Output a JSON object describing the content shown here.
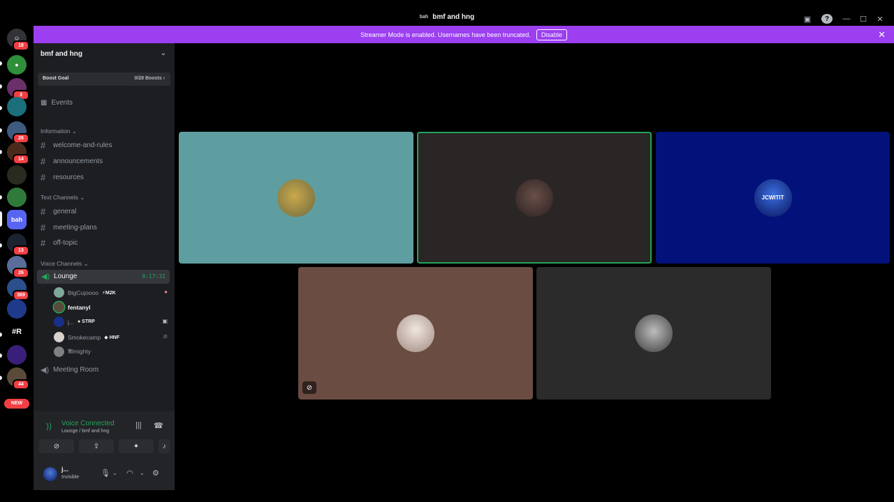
{
  "window": {
    "title": "bmf and hng",
    "title_badge": "bah"
  },
  "banner": {
    "text": "Streamer Mode is enabled. Usernames have been truncated.",
    "button": "Disable"
  },
  "rail": {
    "badges": [
      "18",
      "3",
      "26",
      "14",
      "13",
      "26",
      "369",
      "44"
    ],
    "selected_label": "bah",
    "text_server": "#R",
    "new_label": "NEW"
  },
  "sidebar": {
    "guild_name": "bmf and hng",
    "boost": {
      "label": "Boost Goal",
      "progress": "0/28 Boosts"
    },
    "events": "Events",
    "categories": {
      "information": "Information",
      "text": "Text Channels",
      "voice": "Voice Channels"
    },
    "info_channels": [
      "welcome-and-rules",
      "announcements",
      "resources"
    ],
    "text_channels": [
      "general",
      "meeting-plans",
      "off-topic"
    ],
    "voice_channels": {
      "lounge": {
        "name": "Lounge",
        "timer": "9:17:31"
      },
      "meeting": "Meeting Room"
    },
    "members": [
      {
        "name": "BigCujoooo",
        "tag": "M2K"
      },
      {
        "name": "fentanyl",
        "tag": ""
      },
      {
        "name": "j...",
        "tag": "STRP"
      },
      {
        "name": "Smokecamp",
        "tag": "HNF"
      },
      {
        "name": "𝕬lmighty",
        "tag": ""
      }
    ]
  },
  "voice_panel": {
    "status": "Voice Connected",
    "location": "Lounge / bmf and hng",
    "user_name": "j...",
    "user_status": "Invisible"
  },
  "tiles": [
    {
      "bg": "#5f9ea0",
      "avatar_text": ""
    },
    {
      "bg": "#2a2625",
      "avatar_text": ""
    },
    {
      "bg": "#03127a",
      "avatar_text": "JCWITIT"
    },
    {
      "bg": "#6a4c43",
      "avatar_text": ""
    },
    {
      "bg": "#2b2b2b",
      "avatar_text": ""
    }
  ],
  "colors": {
    "banner": "#9b3ff0",
    "voice_green": "#23a55a",
    "badge_red": "#f23f43",
    "sidebar_bg": "#1d1e22"
  }
}
